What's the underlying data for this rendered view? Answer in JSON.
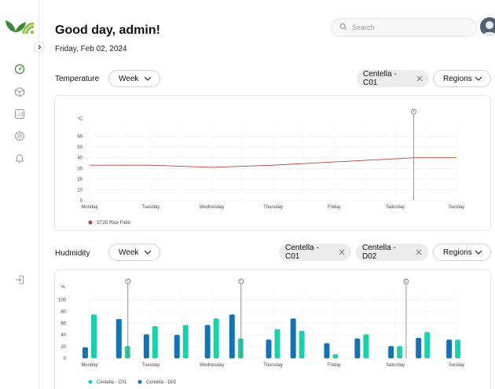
{
  "header": {
    "title": "Good day, admin!",
    "date": "Friday, Feb 02, 2024"
  },
  "search": {
    "placeholder": "Search"
  },
  "icons": {
    "logo": "leaf-wifi-logo",
    "collapse": "chevron-right-icon",
    "nav": [
      "dashboard-gauge-icon",
      "box-icon",
      "chart-icon",
      "gear-icon",
      "bell-icon"
    ],
    "logout": "logout-icon",
    "chip_remove": "close-icon",
    "dropdown": "chevron-down-icon",
    "search": "search-icon"
  },
  "colors": {
    "brand_green": "#3a8a3a",
    "temperature_line": "#b5453a",
    "centella_c01": "#1ccfad",
    "centella_d02": "#1671b5"
  },
  "temperature": {
    "label": "Temperature",
    "period": "Week",
    "chip": "Centella - C01",
    "regions": "Regions"
  },
  "humidity": {
    "label": "Hudmidity",
    "period": "Week",
    "chips": [
      "Centella - C01",
      "Centella - D02"
    ],
    "regions": "Regions"
  },
  "chart_data": [
    {
      "type": "line",
      "ylabel": "°C",
      "categories": [
        "Monday",
        "Tuesday",
        "Wednesday",
        "Thursday",
        "Friday",
        "Saturday",
        "Sunday"
      ],
      "y_ticks": [
        0,
        10,
        20,
        30,
        40,
        50,
        60
      ],
      "ylim": [
        0,
        70
      ],
      "grid": true,
      "legend": "bottom-left",
      "marker_at": 5.3,
      "series": [
        {
          "name": "ST25 Rice Field",
          "color": "#b5453a",
          "x": [
            0,
            1,
            2,
            3,
            4,
            5,
            5.3,
            6
          ],
          "values": [
            33,
            33,
            31,
            33,
            36,
            39,
            40,
            40
          ]
        }
      ]
    },
    {
      "type": "bar",
      "ylabel": "%",
      "categories": [
        "Monday",
        "Tuesday",
        "Wednesday",
        "Thursday",
        "Friday",
        "Saturday",
        "Sunday"
      ],
      "y_ticks": [
        0,
        20,
        40,
        60,
        80,
        100
      ],
      "ylim": [
        0,
        110
      ],
      "grid": true,
      "legend": "bottom-left",
      "marker_at": [
        0.55,
        2.4,
        5.1
      ],
      "bar_pairs": [
        {
          "at": 0.0,
          "values": [
            19,
            75
          ]
        },
        {
          "at": 0.55,
          "values": [
            67,
            21
          ]
        },
        {
          "at": 1.0,
          "values": [
            41,
            55
          ]
        },
        {
          "at": 1.5,
          "values": [
            40,
            57
          ]
        },
        {
          "at": 2.0,
          "values": [
            57,
            68
          ]
        },
        {
          "at": 2.4,
          "values": [
            75,
            34
          ]
        },
        {
          "at": 3.0,
          "values": [
            32,
            50
          ]
        },
        {
          "at": 3.4,
          "values": [
            68,
            47
          ]
        },
        {
          "at": 3.95,
          "values": [
            26,
            7
          ]
        },
        {
          "at": 4.45,
          "values": [
            34,
            41
          ]
        },
        {
          "at": 5.0,
          "values": [
            21,
            21
          ]
        },
        {
          "at": 5.45,
          "values": [
            35,
            45
          ]
        },
        {
          "at": 5.95,
          "values": [
            32,
            32
          ]
        }
      ],
      "series": [
        {
          "name": "Centella - C01",
          "color": "#1ccfad"
        },
        {
          "name": "Centella - D02",
          "color": "#1671b5"
        }
      ]
    }
  ]
}
